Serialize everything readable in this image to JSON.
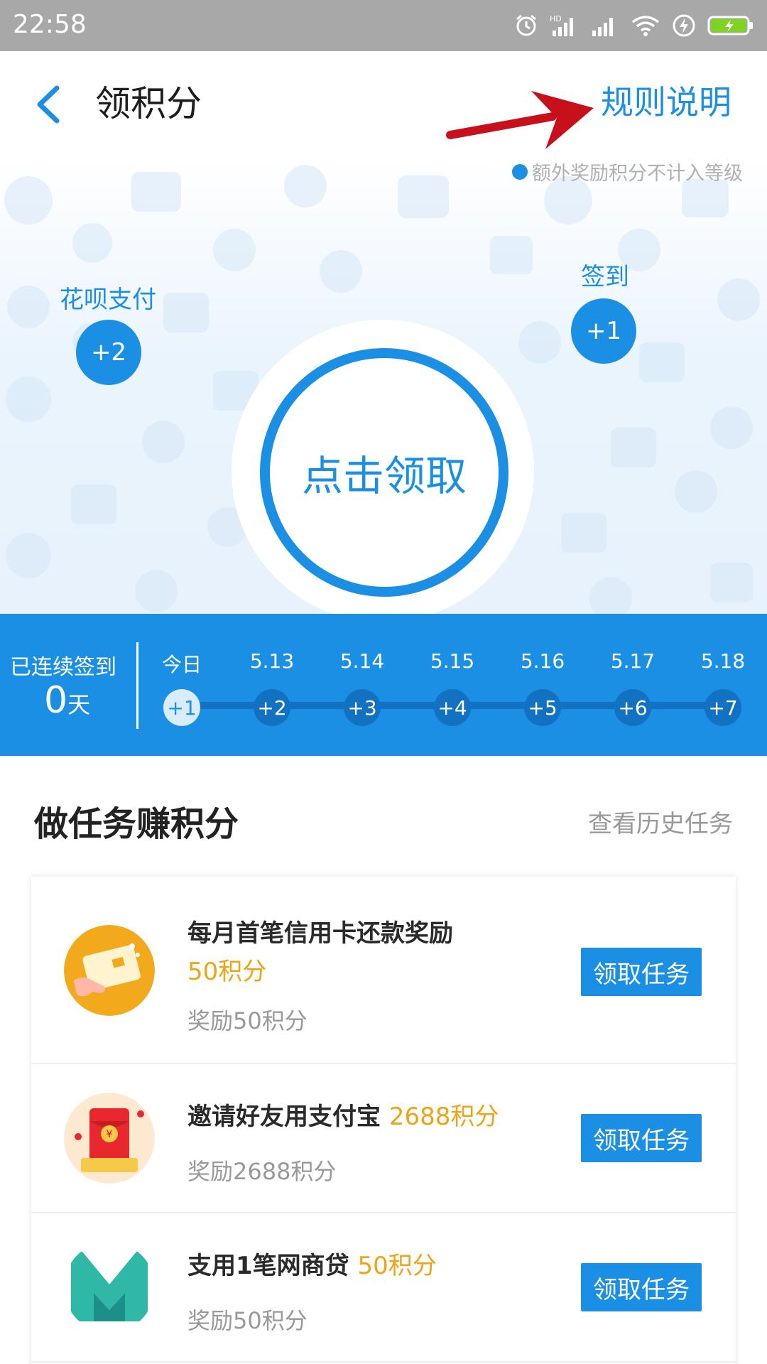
{
  "status_bar": {
    "time": "22:58"
  },
  "header": {
    "title": "领积分",
    "rules_link": "规则说明"
  },
  "hero": {
    "note": "额外奖励积分不计入等级",
    "left_bubble": {
      "label": "花呗支付",
      "value": "+2"
    },
    "right_bubble": {
      "label": "签到",
      "value": "+1"
    },
    "claim_button": "点击领取"
  },
  "streak": {
    "label": "已连续签到",
    "count": "0",
    "unit": "天",
    "days": [
      {
        "date": "今日",
        "points": "+1"
      },
      {
        "date": "5.13",
        "points": "+2"
      },
      {
        "date": "5.14",
        "points": "+3"
      },
      {
        "date": "5.15",
        "points": "+4"
      },
      {
        "date": "5.16",
        "points": "+5"
      },
      {
        "date": "5.17",
        "points": "+6"
      },
      {
        "date": "5.18",
        "points": "+7"
      }
    ]
  },
  "tasks": {
    "title": "做任务赚积分",
    "history_link": "查看历史任务",
    "items": [
      {
        "title": "每月首笔信用卡还款奖励",
        "points": "50积分",
        "reward": "奖励50积分",
        "button": "领取任务",
        "icon": "credit-card-icon"
      },
      {
        "title": "邀请好友用支付宝",
        "points": "2688积分",
        "reward": "奖励2688积分",
        "button": "领取任务",
        "icon": "red-envelope-icon"
      },
      {
        "title": "支用1笔网商贷",
        "points": "50积分",
        "reward": "奖励50积分",
        "button": "领取任务",
        "icon": "mybank-loan-icon"
      }
    ]
  },
  "colors": {
    "accent": "#1a8fe3",
    "points": "#f0a316",
    "status_bar": "#a8a8a8"
  }
}
